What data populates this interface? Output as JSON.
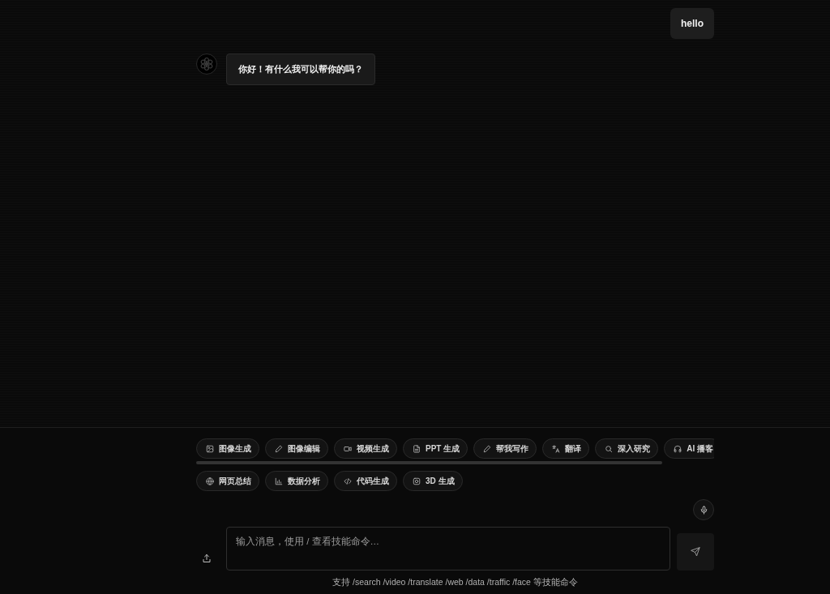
{
  "messages": [
    {
      "kind": "user",
      "text": "hello"
    },
    {
      "kind": "assistant",
      "text": "你好！有什么我可以帮你的吗？"
    }
  ],
  "skills": {
    "row_1": [
      "图像生成",
      "图像编辑",
      "视频生成",
      "PPT 生成",
      "帮我写作",
      "翻译",
      "深入研究",
      "AI 播客"
    ],
    "row_2": [
      "网页总结",
      "数据分析",
      "代码生成",
      "3D 生成"
    ]
  },
  "composer": {
    "placeholder": "输入消息，使用 / 查看技能命令…",
    "hint": "支持 /search /video /translate /web /data /traffic /face 等技能命令"
  }
}
